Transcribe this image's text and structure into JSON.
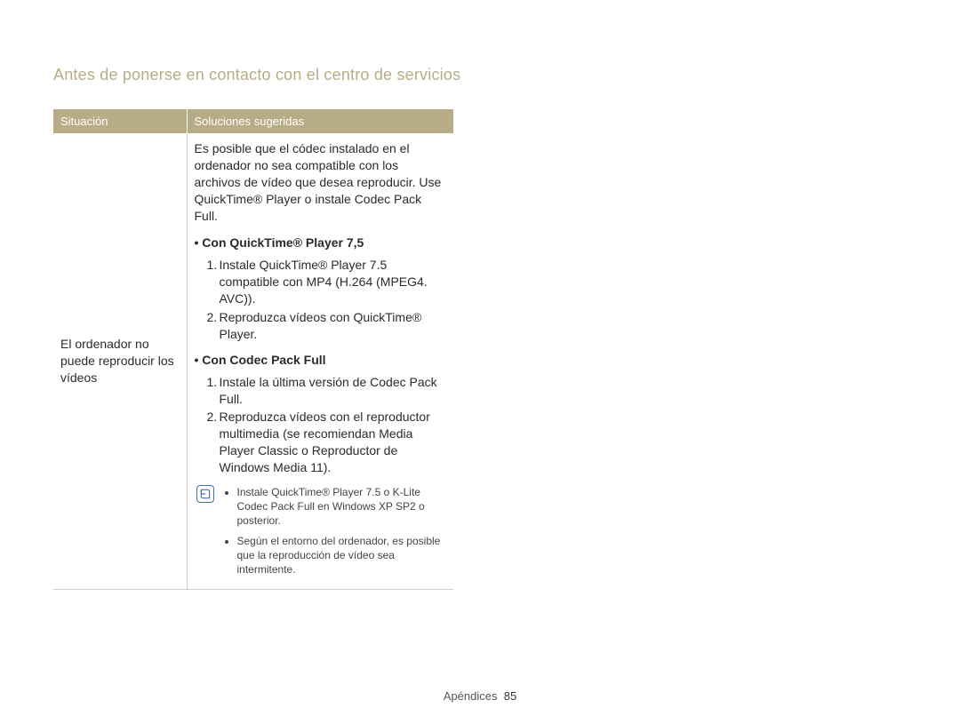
{
  "page_title": "Antes de ponerse en contacto con el centro de servicios",
  "table": {
    "headers": {
      "col1": "Situación",
      "col2": "Soluciones sugeridas"
    },
    "row": {
      "situation": "El ordenador no puede reproducir los vídeos",
      "intro": "Es posible que el códec instalado en el ordenador no sea compatible con los archivos de vídeo que desea reproducir. Use QuickTime® Player o instale Codec Pack Full.",
      "section1": {
        "heading": "• Con QuickTime® Player 7,5",
        "items": [
          "Instale QuickTime® Player 7.5 compatible con MP4 (H.264 (MPEG4. AVC)).",
          "Reproduzca vídeos con QuickTime® Player."
        ]
      },
      "section2": {
        "heading": "• Con Codec Pack Full",
        "items": [
          "Instale la última versión de Codec Pack Full.",
          "Reproduzca vídeos con el reproductor multimedia (se recomiendan Media Player Classic o Reproductor de Windows Media 11)."
        ]
      },
      "notes": [
        "Instale QuickTime® Player 7.5 o K-Lite Codec Pack Full en Windows XP SP2 o posterior.",
        "Según el entorno del ordenador, es posible que la reproducción de vídeo sea intermitente."
      ]
    }
  },
  "footer": {
    "section": "Apéndices",
    "page_number": "85"
  }
}
